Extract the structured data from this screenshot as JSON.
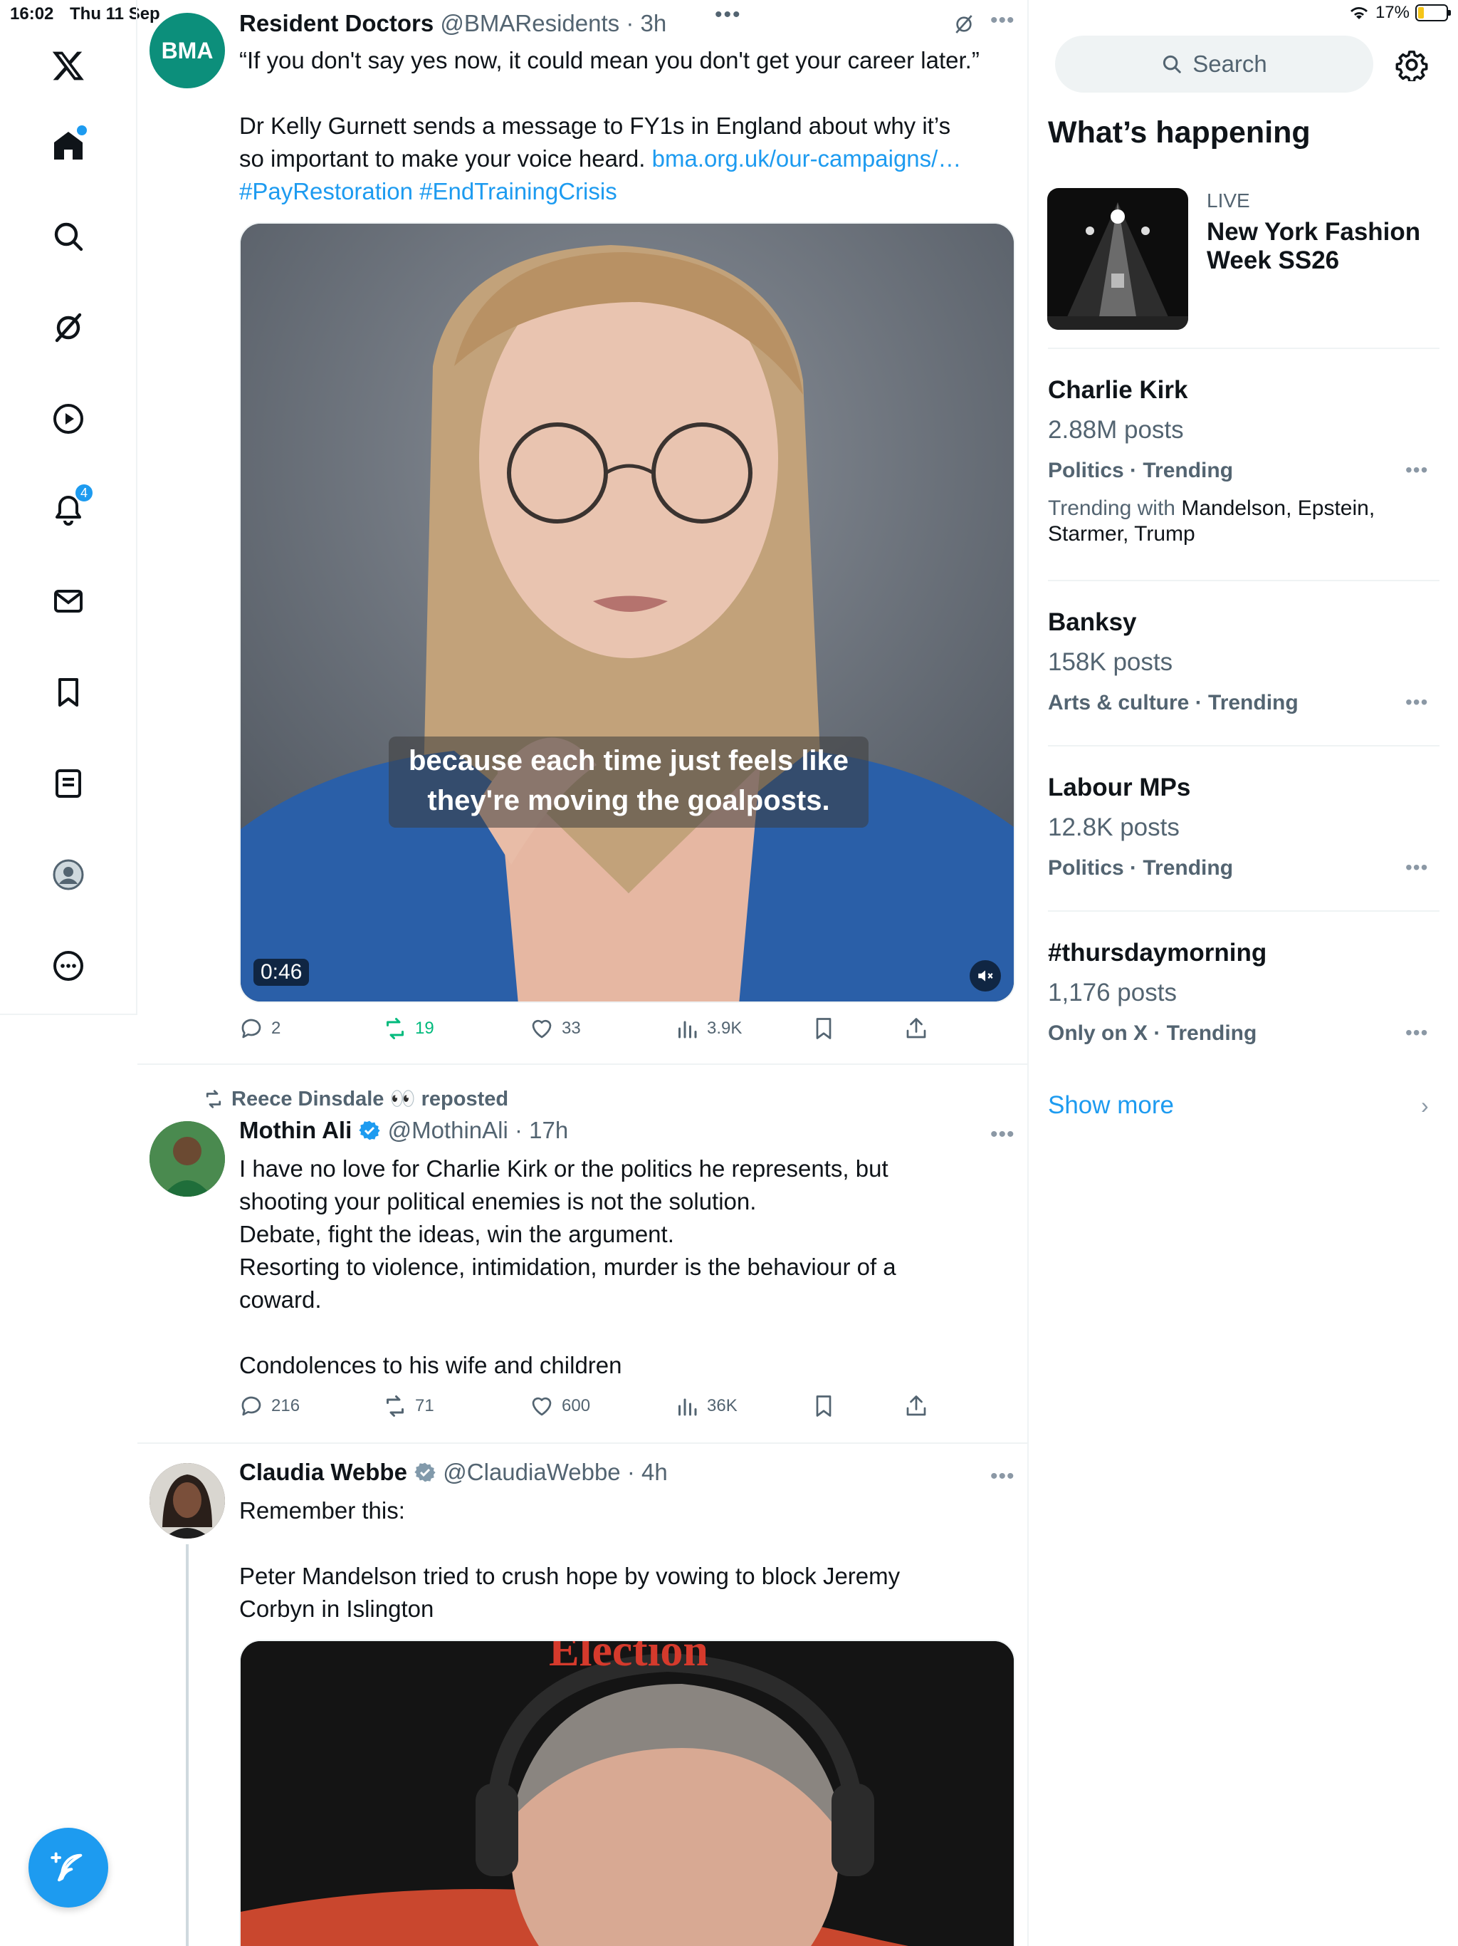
{
  "status_bar": {
    "time": "16:02",
    "date": "Thu 11 Sep",
    "battery": "17%"
  },
  "nav": {
    "notifications_badge": "4"
  },
  "posts": [
    {
      "name": "Resident Doctors",
      "handle": "@BMAResidents",
      "time": "3h",
      "avatar_text": "BMA",
      "text_line1": "“If you don't say yes now, it could mean you don't get your career later.”",
      "text_line2_start": "Dr Kelly Gurnett sends a message to FY1s in England about why it’s so important to make your voice heard.",
      "link": "bma.org.uk/our-campaigns/…",
      "hashtags": "#PayRestoration #EndTrainingCrisis",
      "video_caption_1": "because each time just feels like",
      "video_caption_2": "they're moving the goalposts.",
      "video_duration": "0:46",
      "replies": "2",
      "reposts": "19",
      "likes": "33",
      "views": "3.9K"
    },
    {
      "repost_by": "Reece Dinsdale 👀 reposted",
      "name": "Mothin Ali",
      "handle": "@MothinAli",
      "time": "17h",
      "text_p1": "I have no love for Charlie Kirk or the politics he represents, but shooting your political enemies is not the solution.",
      "text_p2": "Debate, fight the ideas, win the argument.",
      "text_p3": "Resorting to violence,  intimidation,  murder is the behaviour of a coward.",
      "text_p4": "Condolences to his wife and children",
      "replies": "216",
      "reposts": "71",
      "likes": "600",
      "views": "36K"
    },
    {
      "name": "Claudia Webbe",
      "handle": "@ClaudiaWebbe",
      "time": "4h",
      "text_p1": "Remember this:",
      "text_p2": "Peter Mandelson tried to crush hope by vowing to block Jeremy Corbyn in Islington",
      "media_text": "Election"
    }
  ],
  "sidebar": {
    "search_placeholder": "Search",
    "title": "What’s happening",
    "featured": {
      "label": "LIVE",
      "title": "New York Fashion Week SS26"
    },
    "trends": [
      {
        "title": "Charlie Kirk",
        "count": "2.88M posts",
        "meta": "Politics · Trending",
        "with_label": "Trending with",
        "with_names": "Mandelson, Epstein, Starmer, Trump"
      },
      {
        "title": "Banksy",
        "count": "158K posts",
        "meta": "Arts & culture · Trending"
      },
      {
        "title": "Labour MPs",
        "count": "12.8K posts",
        "meta": "Politics · Trending"
      },
      {
        "title": "#thursdaymorning",
        "count": "1,176 posts",
        "meta": "Only on X · Trending"
      }
    ],
    "show_more": "Show more"
  },
  "icons": {
    "verified_color": "#1d9bf0",
    "repost_active_color": "#00ba7c",
    "accent": "#1d9bf0"
  }
}
